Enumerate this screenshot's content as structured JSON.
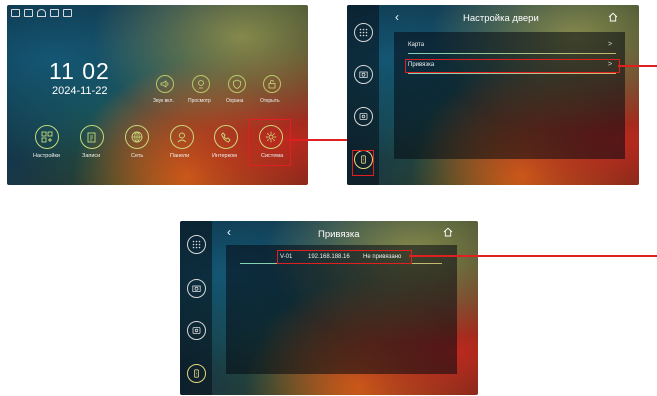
{
  "home": {
    "time": "11 02",
    "date": "2024-11-22",
    "quick": [
      {
        "label": "Звук вкл.",
        "icon": "speaker-icon"
      },
      {
        "label": "Просмотр",
        "icon": "preview-icon"
      },
      {
        "label": "Охрана",
        "icon": "shield-icon"
      },
      {
        "label": "Открыть",
        "icon": "unlock-icon"
      }
    ],
    "menu": [
      {
        "label": "Настройки",
        "icon": "settings-grid-icon"
      },
      {
        "label": "Записи",
        "icon": "records-icon"
      },
      {
        "label": "Сеть",
        "icon": "network-icon"
      },
      {
        "label": "Панели",
        "icon": "panel-icon"
      },
      {
        "label": "Интерком",
        "icon": "intercom-icon"
      },
      {
        "label": "Система",
        "icon": "gear-icon"
      }
    ]
  },
  "door_settings": {
    "title": "Настройка двери",
    "items": [
      {
        "label": "Карта"
      },
      {
        "label": "Привязка"
      }
    ]
  },
  "binding": {
    "title": "Привязка",
    "row": {
      "id": "V-01",
      "ip": "192.168.188.16",
      "status": "Не привязано"
    }
  },
  "colors": {
    "accent": "#c9d97a",
    "highlight": "#e02020"
  }
}
